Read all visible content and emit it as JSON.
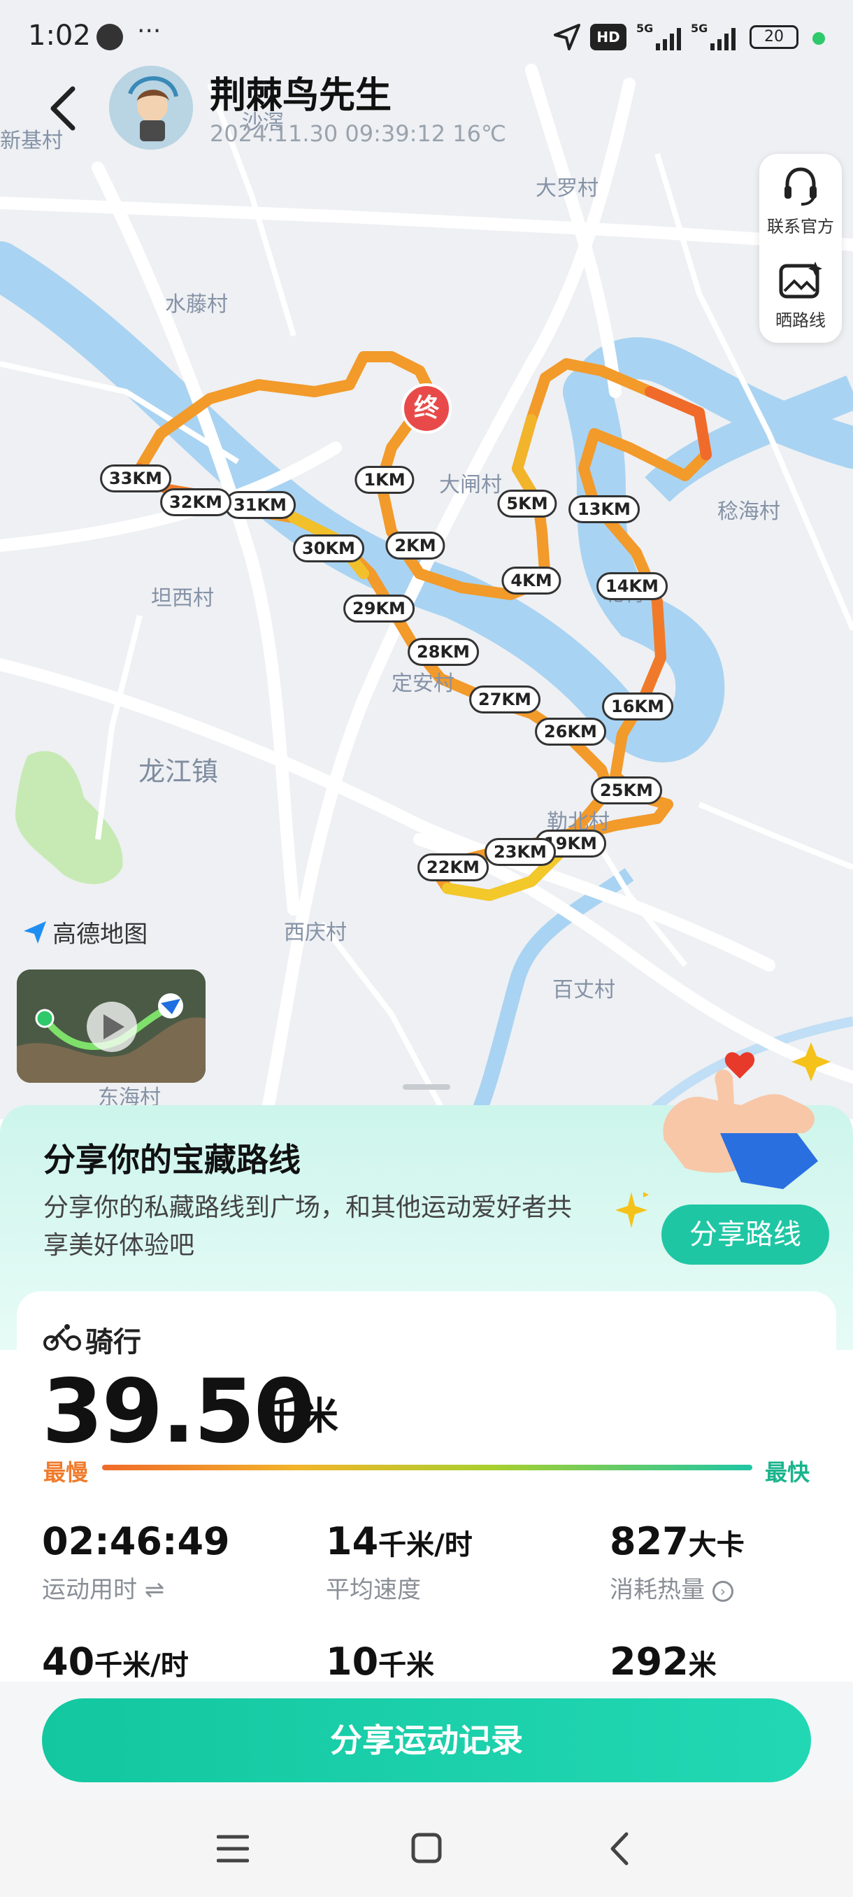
{
  "status_bar": {
    "time": "1:02",
    "battery": "20"
  },
  "header": {
    "username": "荆棘鸟先生",
    "datetime_weather": "2024.11.30 09:39:12  16℃"
  },
  "map": {
    "places": {
      "xinji": "新基村",
      "shagang": "沙滘",
      "daluo": "大罗村",
      "shuiteng": "水藤村",
      "dazha": "大闸村",
      "rihai": "稔海村",
      "tanxi": "坦西村",
      "dingan": "定安村",
      "longjiang": "龙江镇",
      "lebei": "勒北村",
      "xiqing": "西庆村",
      "baizhang": "百丈村",
      "donghai": "东海村",
      "bei": "北村"
    },
    "end_marker": "终",
    "km_tags": [
      "1KM",
      "2KM",
      "4KM",
      "5KM",
      "13KM",
      "14KM",
      "16KM",
      "19KM",
      "22KM",
      "23KM",
      "25KM",
      "26KM",
      "27KM",
      "28KM",
      "29KM",
      "30KM",
      "31KM",
      "32KM",
      "33KM"
    ],
    "logo": "高德地图"
  },
  "float_actions": {
    "contact": "联系官方",
    "show_route": "晒路线"
  },
  "share": {
    "title": "分享你的宝藏路线",
    "desc": "分享你的私藏路线到广场，和其他运动爱好者共享美好体验吧",
    "button": "分享路线"
  },
  "activity": {
    "sport": "骑行",
    "distance": "39.50",
    "distance_unit": "千米",
    "slow_label": "最慢",
    "fast_label": "最快",
    "stats": [
      {
        "value": "02:46:49",
        "unit": "",
        "label": "运动用时 ⇌"
      },
      {
        "value": "14",
        "unit": "千米/时",
        "label": "平均速度"
      },
      {
        "value": "827",
        "unit": "大卡",
        "label": "消耗热量"
      },
      {
        "value": "40",
        "unit": "千米/时",
        "label": ""
      },
      {
        "value": "10",
        "unit": "千米",
        "label": ""
      },
      {
        "value": "292",
        "unit": "米",
        "label": ""
      }
    ]
  },
  "footer": {
    "share_button": "分享运动记录"
  },
  "colors": {
    "accent": "#1fc6a4",
    "route_orange": "#f07a2a",
    "route_yellow": "#f2c02a",
    "end_marker": "#e84a4a"
  }
}
